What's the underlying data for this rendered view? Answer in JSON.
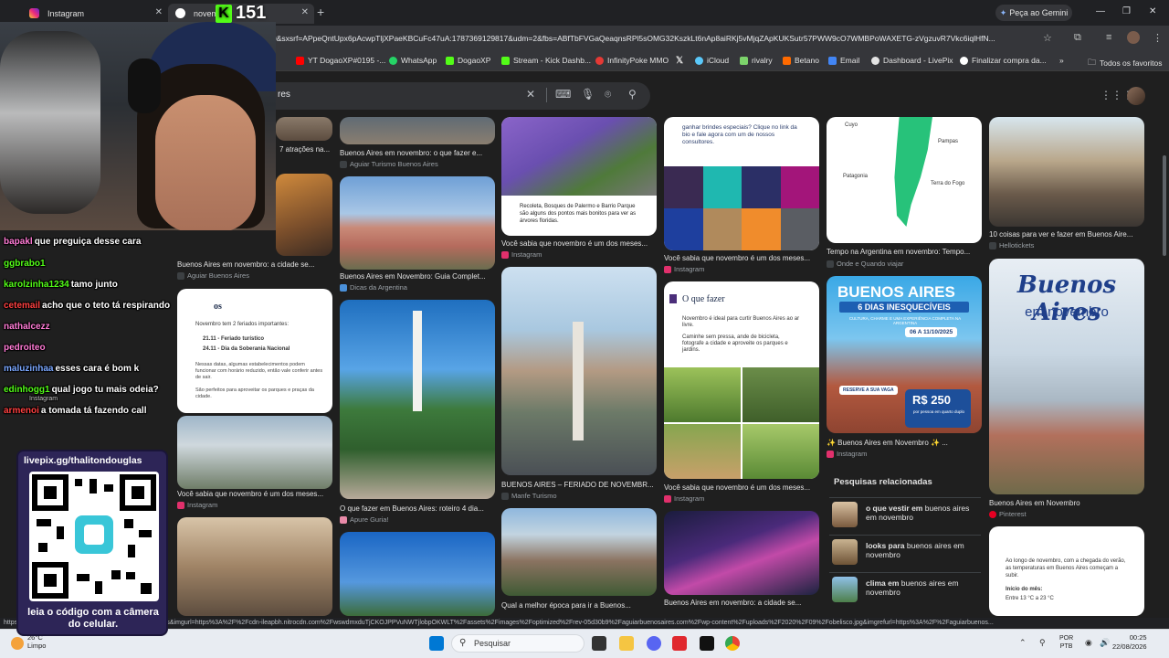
{
  "browser": {
    "tabs": [
      {
        "title": "Instagram",
        "active": false
      },
      {
        "title": "novembro",
        "active": true
      }
    ],
    "gemini_label": "Peça ao Gemini",
    "url": "0&sxsrf=APpeQntUpx6pAcwpTljXPaeKBCuFc47uA:1787369129817&udm=2&fbs=ABfTbFVGaQeaqnsRPl5sOMG32KszkLt6nAp8aiRKj5vMjqZApKUKSutr57PWW9cO7WMBPoWAXETG-zVgzuvR7Vkc6iqlHfN...",
    "bookmarks": [
      {
        "label": "YT DogaoXP#0195 -...",
        "color": "#ff0000"
      },
      {
        "label": "WhatsApp",
        "color": "#25d366"
      },
      {
        "label": "DogaoXP",
        "color": "#53fc18"
      },
      {
        "label": "Stream - Kick Dashb...",
        "color": "#53fc18"
      },
      {
        "label": "InfinityPoke MMO",
        "color": "#e53935"
      },
      {
        "label": "",
        "color": "#cccccc"
      },
      {
        "label": "iCloud",
        "color": "#5ac8fa"
      },
      {
        "label": "rivalry",
        "color": "#7cd36b"
      },
      {
        "label": "Betano",
        "color": "#ff6a00"
      },
      {
        "label": "Email",
        "color": "#4285f4"
      },
      {
        "label": "Dashboard - LivePix",
        "color": "#e3e3e3"
      },
      {
        "label": "Finalizar compra da...",
        "color": "#ffffff"
      }
    ],
    "all_favorites": "Todos os favoritos",
    "status_url": "https://www.google.com/imgres?q=novembro buenos aires&imgurl=https%3A%2F%2Fcdn-ileapbh.nitrocdn.com%2FwswdmxduTjCKOJPPVuNWTjlobpOKWLT%2Fassets%2Fimages%2Foptimized%2Frev-05d30b9%2Faguiarbuenosaires.com%2Fwp-content%2Fuploads%2F2020%2F09%2Fobelisco.jpg&imgrefurl=https%3A%2F%2Faguiarbuenos..."
  },
  "search": {
    "query_fragment": "res"
  },
  "results": {
    "col1": [
      {
        "caption": "7 atrações na...",
        "source": ""
      },
      {
        "caption": "Buenos Aires em novembro: a cidade se...",
        "source": "Aguiar Buenos Aires"
      },
      {
        "caption": "Você sabia que novembro é um dos meses...",
        "source": "Instagram"
      }
    ],
    "col1_card2_title": "os",
    "col1_card2_lines": [
      "Novembro tem 2 feriados importantes:",
      "21.11 - Feriado turístico",
      "24.11 - Dia da Soberania Nacional",
      "Nessas datas, algumas estabelecimentos podem funcionar com horário reduzido, então vale conferir antes de sair.",
      "São perfeitos para aproveitar os parques e praças da cidade."
    ],
    "col2": [
      {
        "caption": "Buenos Aires em novembro: o que fazer e...",
        "source": "Aguiar Turismo Buenos Aires"
      },
      {
        "caption": "Buenos Aires em Novembro: Guia Complet...",
        "source": "Dicas da Argentina"
      },
      {
        "caption": "O que fazer em Buenos Aires: roteiro 4 dia...",
        "source": "Apure Guria!"
      }
    ],
    "col3": [
      {
        "caption": "Você sabia que novembro é um dos meses...",
        "source": "Instagram"
      },
      {
        "caption": "BUENOS AIRES – FERIADO DE NOVEMBR...",
        "source": "Manfe Turismo"
      },
      {
        "caption": "Qual a melhor época para ir a Buenos...",
        "source": ""
      }
    ],
    "col3_card1_text": "Recoleta, Bosques de Palermo e Barrio Parque são alguns dos pontos mais bonitos para ver as árvores floridas.",
    "col4": [
      {
        "caption": "Você sabia que novembro é um dos meses...",
        "source": "Instagram"
      },
      {
        "caption": "Você sabia que novembro é um dos meses...",
        "source": "Instagram"
      },
      {
        "caption": "Buenos Aires em novembro: a cidade se...",
        "source": "Aguiar Buenos Aires"
      }
    ],
    "col4_card1_text": "ganhar brindes especiais? Clique no link da bio e fale agora com um de nossos consultores.",
    "col4_card2_title": "O que fazer",
    "col4_card2_lines": [
      "Novembro é ideal para curtir Buenos Aires ao ar livre.",
      "Caminhe sem pressa, ande de bicicleta, fotografe a cidade e aproveite os parques e jardins."
    ],
    "col5": [
      {
        "caption": "Tempo na Argentina em novembro: Tempo...",
        "source": "Onde e Quando viajar"
      },
      {
        "caption": "✨ Buenos Aires em Novembro ✨ ...",
        "source": "Instagram"
      }
    ],
    "col5_map_labels": [
      "Cuyo",
      "Pampas",
      "Patagonia",
      "Terra do Fogo"
    ],
    "col5_ad": {
      "title": "BUENOS AIRES",
      "subtitle": "6 DIAS INESQUECÍVEIS",
      "tagline": "CULTURA, CHARME E UMA EXPERIÊNCIA COMPLETA NA ARGENTINA",
      "date": "06 A 11/10/2025",
      "price": "R$ 250",
      "price_note": "por pessoa em quarto duplo",
      "cta": "RESERVE A SUA VAGA"
    },
    "col6": [
      {
        "caption": "10 coisas para ver e fazer em Buenos Aire...",
        "source": "Hellotickets"
      },
      {
        "caption": "Buenos Aires em Novembro",
        "source": "Pinterest"
      }
    ],
    "col6_card2_title": "Buenos Aires",
    "col6_card2_subtitle": "em novembro",
    "col6_card3_lines": [
      "Ao longo de novembro, com a chegada do verão, as temperaturas em Buenos Aires começam a subir.",
      "Início do mês:",
      "Entre 13 °C a 23 °C"
    ]
  },
  "related": {
    "title": "Pesquisas relacionadas",
    "items": [
      {
        "bold": "o que vestir em",
        "rest": "buenos aires em novembro"
      },
      {
        "bold": "looks para",
        "rest": "buenos aires em novembro"
      },
      {
        "bold": "clima em",
        "rest": "buenos aires em novembro"
      }
    ]
  },
  "stream": {
    "viewers": "151",
    "chat": [
      {
        "user": "bapakl",
        "color": "#ff7bd5",
        "msg": "que preguiça desse cara"
      },
      {
        "user": "ggbrabo1",
        "color": "#53fc18",
        "msg": ""
      },
      {
        "user": "karolzinha1234",
        "color": "#53fc18",
        "msg": "tamo junto"
      },
      {
        "user": "cetemail",
        "color": "#ff4040",
        "msg": "acho que o teto tá respirando"
      },
      {
        "user": "nathalcezz",
        "color": "#ff7bd5",
        "msg": ""
      },
      {
        "user": "pedroiteo",
        "color": "#ff7bd5",
        "msg": ""
      },
      {
        "user": "maluzinhaa",
        "color": "#7aa7ff",
        "msg": "esses cara é bom k"
      },
      {
        "user": "edinhogg1",
        "color": "#53fc18",
        "msg": "qual jogo tu mais odeia?"
      },
      {
        "user": "armenoi",
        "color": "#ff4040",
        "msg": "a tomada tá fazendo call"
      }
    ],
    "chat_small_label": "Instagram",
    "qr_url": "livepix.gg/thalitondouglas",
    "qr_caption": "leia o código com a câmera do celular."
  },
  "taskbar": {
    "weather_temp": "26°C",
    "weather_desc": "Limpo",
    "search_label": "Pesquisar",
    "lang_1": "POR",
    "lang_2": "PTB",
    "time": "00:25",
    "date": "22/08/2026"
  }
}
